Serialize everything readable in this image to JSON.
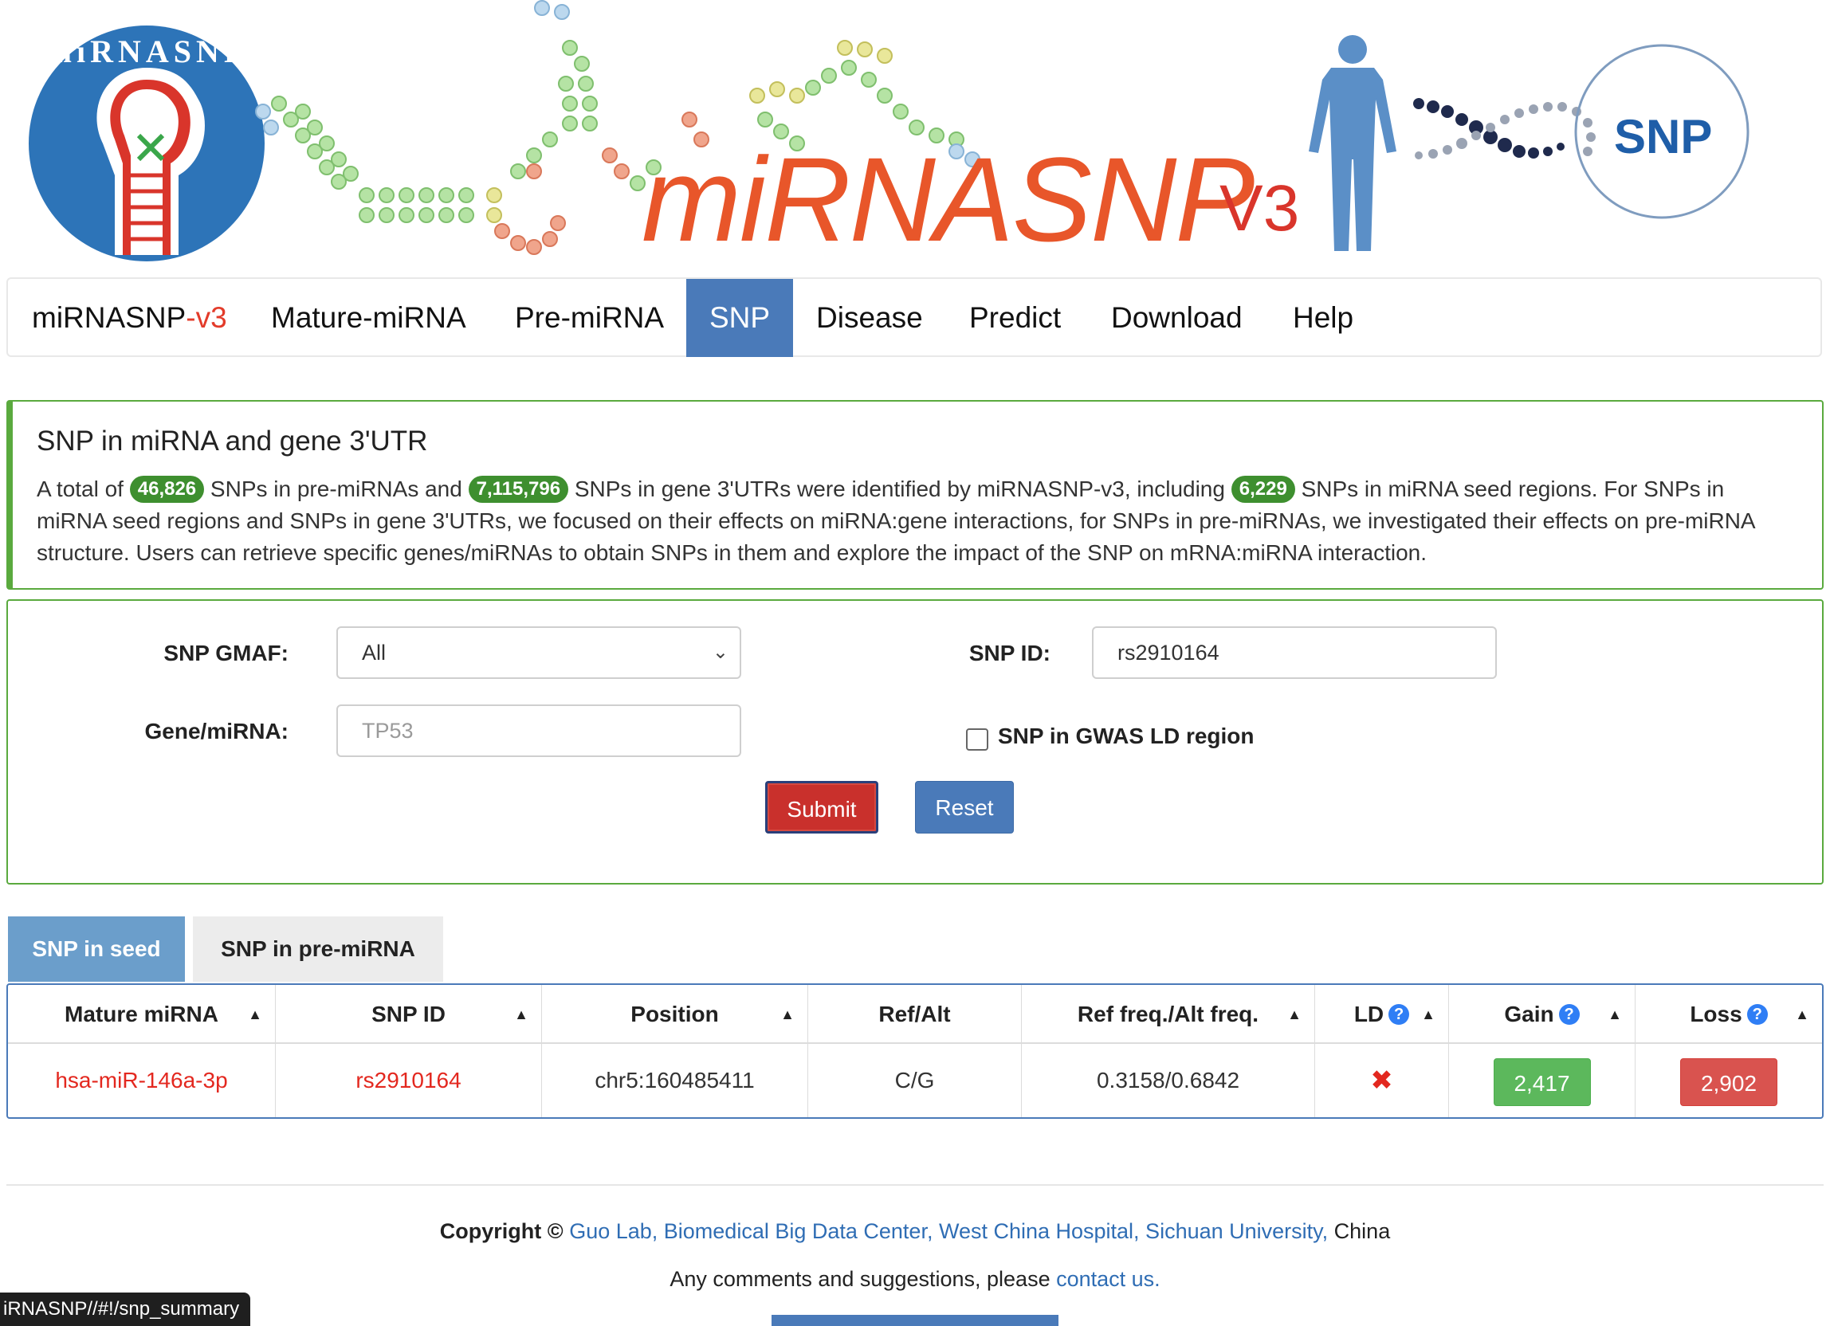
{
  "banner": {
    "logo_text": "miRNASNP",
    "title": "miRNASNP",
    "version": "V3",
    "snp_badge": "SNP"
  },
  "nav": {
    "brand_main": "miRNASNP",
    "brand_suffix": "-v3",
    "items": [
      "Mature-miRNA",
      "Pre-miRNA",
      "SNP",
      "Disease",
      "Predict",
      "Download",
      "Help"
    ],
    "active": "SNP"
  },
  "summary": {
    "heading": "SNP in miRNA and gene 3'UTR",
    "text_1": "A total of ",
    "count_premirna": "46,826",
    "text_2": " SNPs in pre-miRNAs and ",
    "count_utr": "7,115,796",
    "text_3": " SNPs in gene 3'UTRs were identified by miRNASNP-v3, including ",
    "count_seed": "6,229",
    "text_4": " SNPs in miRNA seed regions. For SNPs in miRNA seed regions and SNPs in gene 3'UTRs, we focused on their effects on miRNA:gene interactions, for SNPs in pre-miRNAs, we investigated their effects on pre-miRNA structure. Users can retrieve specific genes/miRNAs to obtain SNPs in them and explore the impact of the SNP on mRNA:miRNA interaction."
  },
  "form": {
    "gmaf_label": "SNP GMAF:",
    "gmaf_value": "All",
    "snp_id_label": "SNP ID:",
    "snp_id_value": "rs2910164",
    "gene_label": "Gene/miRNA:",
    "gene_placeholder": "TP53",
    "gwas_label": "SNP in GWAS LD region",
    "gwas_checked": false,
    "submit_label": "Submit",
    "reset_label": "Reset"
  },
  "tabs": {
    "seed": "SNP in seed",
    "premirna": "SNP in pre-miRNA",
    "active": "seed"
  },
  "table": {
    "headers": [
      "Mature miRNA",
      "SNP ID",
      "Position",
      "Ref/Alt",
      "Ref freq./Alt freq.",
      "LD",
      "Gain",
      "Loss"
    ],
    "rows": [
      {
        "mature_mirna": "hsa-miR-146a-3p",
        "snp_id": "rs2910164",
        "position": "chr5:160485411",
        "ref_alt": "C/G",
        "freq": "0.3158/0.6842",
        "ld": "✖",
        "gain": "2,417",
        "loss": "2,902"
      }
    ]
  },
  "footer": {
    "copyright_prefix": "Copyright ©",
    "copyright_link": "Guo Lab, Biomedical Big Data Center, West China Hospital, Sichuan University,",
    "copyright_suffix": "China",
    "comments_text": "Any comments and suggestions, please",
    "contact_link": "contact us."
  },
  "status_bar": {
    "url": "iRNASNP//#!/snp_summary"
  },
  "colors": {
    "nav_active": "#4a7ab9",
    "panel_border": "#5aaa3e",
    "badge_green": "#3e8f2f",
    "submit_red": "#c9302c",
    "gain_green": "#5cb85c",
    "loss_red": "#d9534f",
    "link_blue": "#2f6db4",
    "brand_orange": "#e8562a"
  }
}
